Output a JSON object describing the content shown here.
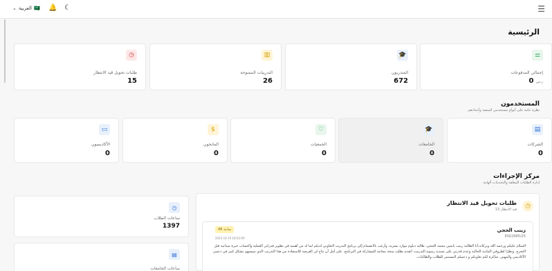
{
  "topbar": {
    "lang_label": "العربية",
    "lang_flag": "🇸🇦",
    "menu_icon": "menu-icon",
    "bell_icon": "bell-icon",
    "moon_icon": "moon-icon"
  },
  "home": {
    "title": "الرئيسية"
  },
  "summary_cards": [
    {
      "label": "إجمالي المدفوعات",
      "value": "0",
      "unit": "ر.س",
      "icon": "currency-icon",
      "color": "#e8f6ec",
      "fg": "#1f9d55"
    },
    {
      "label": "المتدربون",
      "value": "672",
      "icon": "graduation-icon",
      "color": "#e8f0fb",
      "fg": "#2e6fd8"
    },
    {
      "label": "التدريبات الممنوحة",
      "value": "26",
      "icon": "book-icon",
      "color": "#fff4d6",
      "fg": "#d4a000"
    },
    {
      "label": "طلبات تحويل قيد الانتظار",
      "value": "15",
      "icon": "clock-icon",
      "color": "#fde8e8",
      "fg": "#d63a3a"
    }
  ],
  "users": {
    "title": "المستخدمون",
    "subtitle": "نظرة عامة على أنواع مستخدمي المنصة وأعدادهم",
    "cards": [
      {
        "label": "الشركات",
        "value": "0",
        "icon": "building-icon",
        "color": "#e8f0fb",
        "fg": "#2e6fd8"
      },
      {
        "label": "الجامعات",
        "value": "0",
        "icon": "graduation-icon",
        "color": "#e8f0fb",
        "fg": "#2e6fd8"
      },
      {
        "label": "الجمعيات",
        "value": "0",
        "icon": "heart-icon",
        "color": "#e8f6ec",
        "fg": "#1f9d55"
      },
      {
        "label": "المانحون",
        "value": "0",
        "icon": "coin-icon",
        "color": "#fff4d6",
        "fg": "#d4a000"
      },
      {
        "label": "الأكاديميون",
        "value": "0",
        "icon": "book-open-icon",
        "color": "#e8f0fb",
        "fg": "#2e6fd8"
      }
    ]
  },
  "actions": {
    "title": "مركز الإجراءات",
    "subtitle": "إدارة الطلبات المعلقة والتحديثات الهامة"
  },
  "pending": {
    "title": "طلبات تحويل قيد الانتظار",
    "subtitle": "13 قيد الانتظار",
    "request": {
      "name": "زينب الحجي",
      "id": "ES02985/25",
      "badge": "48 ساعة",
      "date": "2025-10-19 18:52:09",
      "message": "السلام عليكم ورحمة الله وبركاته،أنا الطالبة زينب ياسين محمد الحجي، طالبة دبلوم موارد بشرية، وأرغب بالانضمام إلى برنامج التدريب التعاوني لديكم لما له من أهمية في تطوير قدراتي العملية واكتساب خبرة ميدانية قبل التخرج. ونظرًا لظروفي المادية الحالية وعدم قدرتي على تسديد رسوم التدريب، أتقدم بطلب منحة مجانية للمشاركة في البرنامج، على أمل أن تتاح لي الفرصة للاستفادة من هذا التدريب الذي سيسهم بشكل كبير في دعمي الأكاديمي والمهني. شاكرة لكم تعاونكم و دعمكم المستمر للطلاب والطالبات.",
      "progress": 0.45
    }
  },
  "side_stats": [
    {
      "label": "ساعات الطلاب",
      "value": "1397",
      "icon": "clock-icon"
    },
    {
      "label": "ساعات الجامعات",
      "value": "",
      "icon": "building-icon"
    }
  ]
}
